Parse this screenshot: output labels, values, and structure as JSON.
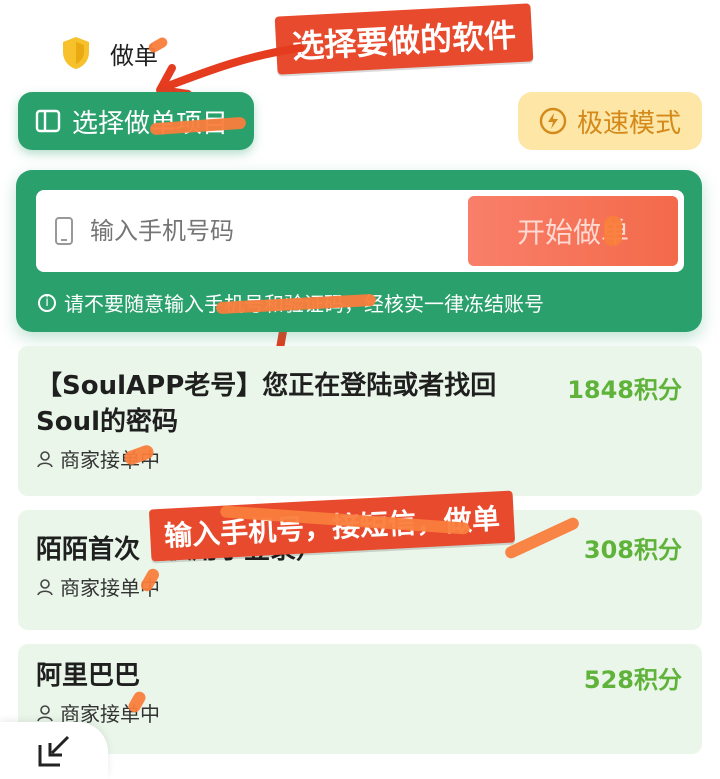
{
  "top": {
    "label": "做单"
  },
  "callouts": {
    "pick_software": "选择要做的软件",
    "enter_phone": "输入手机号，接短信，做单"
  },
  "toolbar": {
    "select_project": "选择做单项目",
    "speed_mode": "极速模式"
  },
  "form": {
    "phone_placeholder": "输入手机号码",
    "start_label": "开始做单",
    "notice": "请不要随意输入手机号和验证码，经核实一律冻结账号"
  },
  "tasks": [
    {
      "title": "【SoulAPP老号】您正在登陆或者找回",
      "title2": "Soul的密码",
      "points": "1848积分",
      "merchant": "商家接单中"
    },
    {
      "title": "陌陌首次（仅用于登录）",
      "points": "308积分",
      "merchant": "商家接单中"
    },
    {
      "title": "阿里巴巴",
      "points": "528积分",
      "merchant": "商家接单中"
    }
  ],
  "colors": {
    "green": "#2aa06c",
    "orange": "#f97d3c",
    "red_callout": "#e84a2d",
    "points": "#5fb33a"
  },
  "icons": [
    "shield-icon",
    "book-icon",
    "lightning-icon",
    "phone-icon",
    "info-icon",
    "person-icon",
    "collapse-icon"
  ]
}
